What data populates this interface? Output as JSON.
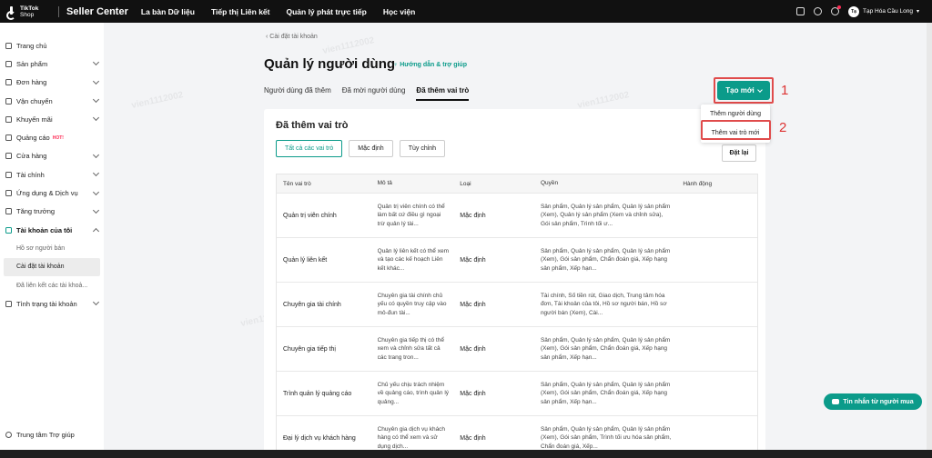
{
  "topbar": {
    "logo_line1": "TikTok",
    "logo_line2": "Shop",
    "app_title": "Seller Center",
    "nav": [
      "La bàn Dữ liệu",
      "Tiếp thị Liên kết",
      "Quản lý phát trực tiếp",
      "Học viện"
    ],
    "user_initials": "Tạ",
    "user_name": "Tạp Hóa Cầu Long"
  },
  "sidebar": {
    "items": [
      {
        "label": "Trang chủ",
        "icon": "home-icon"
      },
      {
        "label": "Sản phẩm",
        "icon": "box-icon"
      },
      {
        "label": "Đơn hàng",
        "icon": "order-icon"
      },
      {
        "label": "Vận chuyển",
        "icon": "truck-icon"
      },
      {
        "label": "Khuyến mãi",
        "icon": "tag-icon"
      },
      {
        "label": "Quảng cáo",
        "icon": "megaphone-icon",
        "badge": "HOT!"
      },
      {
        "label": "Cửa hàng",
        "icon": "store-icon"
      },
      {
        "label": "Tài chính",
        "icon": "wallet-icon"
      },
      {
        "label": "Ứng dụng & Dịch vụ",
        "icon": "apps-icon"
      },
      {
        "label": "Tăng trưởng",
        "icon": "growth-icon"
      },
      {
        "label": "Tài khoản của tôi",
        "icon": "user-icon"
      }
    ],
    "account_sub": [
      "Hồ sơ người bán",
      "Cài đặt tài khoản",
      "Đã liên kết các tài khoả..."
    ],
    "account_status": "Tình trạng tài khoản",
    "help_center": "Trung tâm Trợ giúp"
  },
  "main": {
    "breadcrumb": "Cài đặt tài khoản",
    "title": "Quản lý người dùng",
    "help_link": "Hướng dẫn & trợ giúp",
    "tabs": [
      "Người dùng đã thêm",
      "Đã mời người dùng",
      "Đã thêm vai trò"
    ],
    "create_button": "Tạo mới",
    "dropdown": [
      "Thêm người dùng",
      "Thêm vai trò mới"
    ],
    "annotations": [
      "1",
      "2"
    ],
    "section_title": "Đã thêm vai trò",
    "filters": [
      "Tất cả các vai trò",
      "Mặc định",
      "Tùy chỉnh"
    ],
    "reset_button": "Đặt lại",
    "table": {
      "headers": [
        "Tên vai trò",
        "Mô tả",
        "Loại",
        "Quyền",
        "Hành động"
      ],
      "rows": [
        {
          "name": "Quản trị viên chính",
          "desc": "Quản trị viên chính có thể làm bất cứ điều gì ngoại trừ quản lý tài...",
          "type": "Mặc định",
          "perm": "Sản phẩm, Quản lý sản phẩm, Quản lý sản phẩm (Xem), Quản lý sản phẩm (Xem và chỉnh sửa), Gói sản phẩm, Trình tối ư..."
        },
        {
          "name": "Quản lý liên kết",
          "desc": "Quản lý liên kết có thể xem và tạo các kế hoạch Liên kết khác...",
          "type": "Mặc định",
          "perm": "Sản phẩm, Quản lý sản phẩm, Quản lý sản phẩm (Xem), Gói sản phẩm, Chẩn đoán giá, Xếp hạng sản phẩm, Xếp hạn..."
        },
        {
          "name": "Chuyên gia tài chính",
          "desc": "Chuyên gia tài chính chủ yếu có quyền truy cập vào mô-đun tài...",
          "type": "Mặc định",
          "perm": "Tài chính, Số tiền rút, Giao dịch, Trung tâm hóa đơn, Tài khoản của tôi, Hồ sơ người bán, Hồ sơ người bán (Xem), Cài..."
        },
        {
          "name": "Chuyên gia tiếp thị",
          "desc": "Chuyên gia tiếp thị có thể xem và chỉnh sửa tất cả các trang tron...",
          "type": "Mặc định",
          "perm": "Sản phẩm, Quản lý sản phẩm, Quản lý sản phẩm (Xem), Gói sản phẩm, Chẩn đoán giá, Xếp hạng sản phẩm, Xếp hạn..."
        },
        {
          "name": "Trình quản lý quảng cáo",
          "desc": "Chủ yếu chịu trách nhiệm về quảng cáo, trình quản lý quảng...",
          "type": "Mặc định",
          "perm": "Sản phẩm, Quản lý sản phẩm, Quản lý sản phẩm (Xem), Gói sản phẩm, Chẩn đoán giá, Xếp hạng sản phẩm, Xếp hạn..."
        },
        {
          "name": "Đại lý dịch vụ khách hàng",
          "desc": "Chuyên gia dịch vụ khách hàng có thể xem và sử dụng dịch...",
          "type": "Mặc định",
          "perm": "Sản phẩm, Quản lý sản phẩm, Quản lý sản phẩm (Xem), Gói sản phẩm, Trình tối ưu hóa sản phẩm, Chẩn đoán giá, Xếp..."
        }
      ]
    },
    "chat_button": "Tin nhắn từ người mua",
    "watermark": "vien1112002"
  },
  "colors": {
    "accent": "#0b9b8a",
    "annotation": "#e04b4b",
    "topbar": "#111111"
  }
}
